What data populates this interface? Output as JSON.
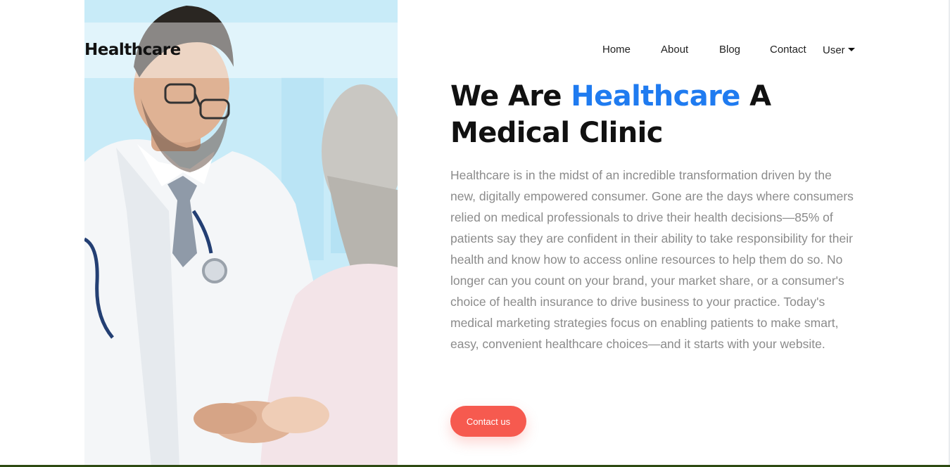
{
  "brand": {
    "name": "Healthcare"
  },
  "nav": {
    "items": [
      "Home",
      "About",
      "Blog",
      "Contact"
    ],
    "user_label": "User"
  },
  "hero": {
    "title_part1": "We Are ",
    "title_accent": "Healthcare",
    "title_part2": " A Medical Clinic",
    "paragraph": "Healthcare is in the midst of an incredible transformation driven by the new, digitally empowered consumer. Gone are the days where consumers relied on medical professionals to drive their health decisions—85% of patients say they are confident in their ability to take responsibility for their health and know how to access online resources to help them do so. No longer can you count on your brand, your market share, or a consumer's choice of health insurance to drive business to your practice. Today's medical marketing strategies focus on enabling patients to make smart, easy, convenient healthcare choices—and it starts with your website.",
    "cta_label": "Contact us"
  },
  "colors": {
    "accent": "#1f7bf0",
    "cta": "#f65a4f",
    "text_muted": "#8b8b8b"
  },
  "icons": {
    "user_dropdown": "caret-down-icon"
  }
}
